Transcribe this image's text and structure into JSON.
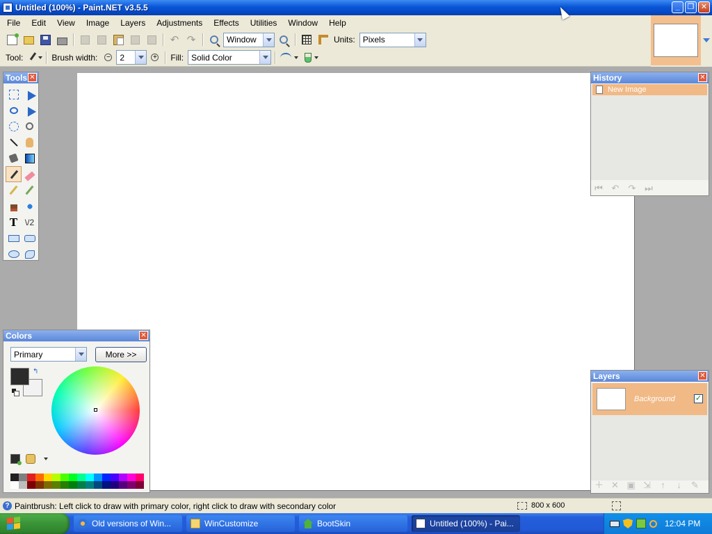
{
  "window": {
    "title": "Untitled (100%) - Paint.NET v3.5.5",
    "minimize": "_",
    "maximize": "❐",
    "close": "✕"
  },
  "menu": [
    "File",
    "Edit",
    "View",
    "Image",
    "Layers",
    "Adjustments",
    "Effects",
    "Utilities",
    "Window",
    "Help"
  ],
  "toolbar1": {
    "zoom_value": "Window",
    "units_label": "Units:",
    "units_value": "Pixels"
  },
  "toolbar2": {
    "tool_label": "Tool:",
    "brush_width_label": "Brush width:",
    "brush_width_value": "2",
    "fill_label": "Fill:",
    "fill_value": "Solid Color",
    "minus": "−",
    "plus": "+"
  },
  "panels": {
    "tools_title": "Tools",
    "history_title": "History",
    "colors_title": "Colors",
    "layers_title": "Layers",
    "close_glyph": "✕"
  },
  "tools": [
    "rect-select",
    "move",
    "lasso",
    "ellipse-select",
    "magnifier",
    "magic-wand",
    "hand",
    "bucket",
    "gradient",
    "paintbrush",
    "eraser",
    "pencil",
    "picker",
    "stamp",
    "recolor",
    "text",
    "line-tool",
    "rectangle",
    "rounded",
    "ellipse",
    "freeform"
  ],
  "tools_layout": [
    "rect-select",
    "move",
    "lasso",
    "move",
    "ellipse-select",
    "magnifier",
    "magic-wand",
    "hand",
    "bucket",
    "gradient",
    "paintbrush",
    "eraser",
    "pencil",
    "picker",
    "stamp",
    "recolor",
    "text",
    "line-tool",
    "rectangle",
    "rounded",
    "ellipse",
    "freeform"
  ],
  "active_tool": "paintbrush",
  "history": {
    "items": [
      "New Image"
    ],
    "nav": [
      "⏮",
      "↶",
      "↷",
      "⏭"
    ]
  },
  "colors": {
    "mode_value": "Primary",
    "more_label": "More >>",
    "primary": "#2b2b2b",
    "secondary": "#f2f2f2",
    "swap_glyph": "↰",
    "palette_top": [
      "#202020",
      "#7f7f7f",
      "#e02020",
      "#ff6a00",
      "#ffd800",
      "#b6ff00",
      "#4cff00",
      "#00ff21",
      "#00ff90",
      "#00ffff",
      "#0094ff",
      "#0026ff",
      "#4800ff",
      "#b200ff",
      "#ff00dc",
      "#ff006e"
    ],
    "palette_bottom": [
      "#ffffff",
      "#bdbdbd",
      "#7f0000",
      "#7f3300",
      "#7f6a00",
      "#5b7f00",
      "#267f00",
      "#007f0e",
      "#007f46",
      "#007f7f",
      "#004a7f",
      "#00137f",
      "#21007f",
      "#57007f",
      "#7f006e",
      "#7f0037"
    ]
  },
  "layers": {
    "items": [
      {
        "name": "Background",
        "visible": "✓"
      }
    ],
    "tool_glyphs": [
      "＋",
      "✕",
      "▣",
      "⇲",
      "↑",
      "↓",
      "✎"
    ]
  },
  "status": {
    "help": "?",
    "text": "Paintbrush: Left click to draw with primary color, right click to draw with secondary color",
    "image_size": "800 x 600"
  },
  "taskbar": {
    "start": "start",
    "tasks": [
      {
        "label": "Old versions of Win...",
        "icon": "ie"
      },
      {
        "label": "WinCustomize",
        "icon": "folder"
      },
      {
        "label": "BootSkin",
        "icon": "home"
      },
      {
        "label": "Untitled (100%) - Pai...",
        "icon": "pdn"
      }
    ],
    "clock": "12:04 PM"
  }
}
